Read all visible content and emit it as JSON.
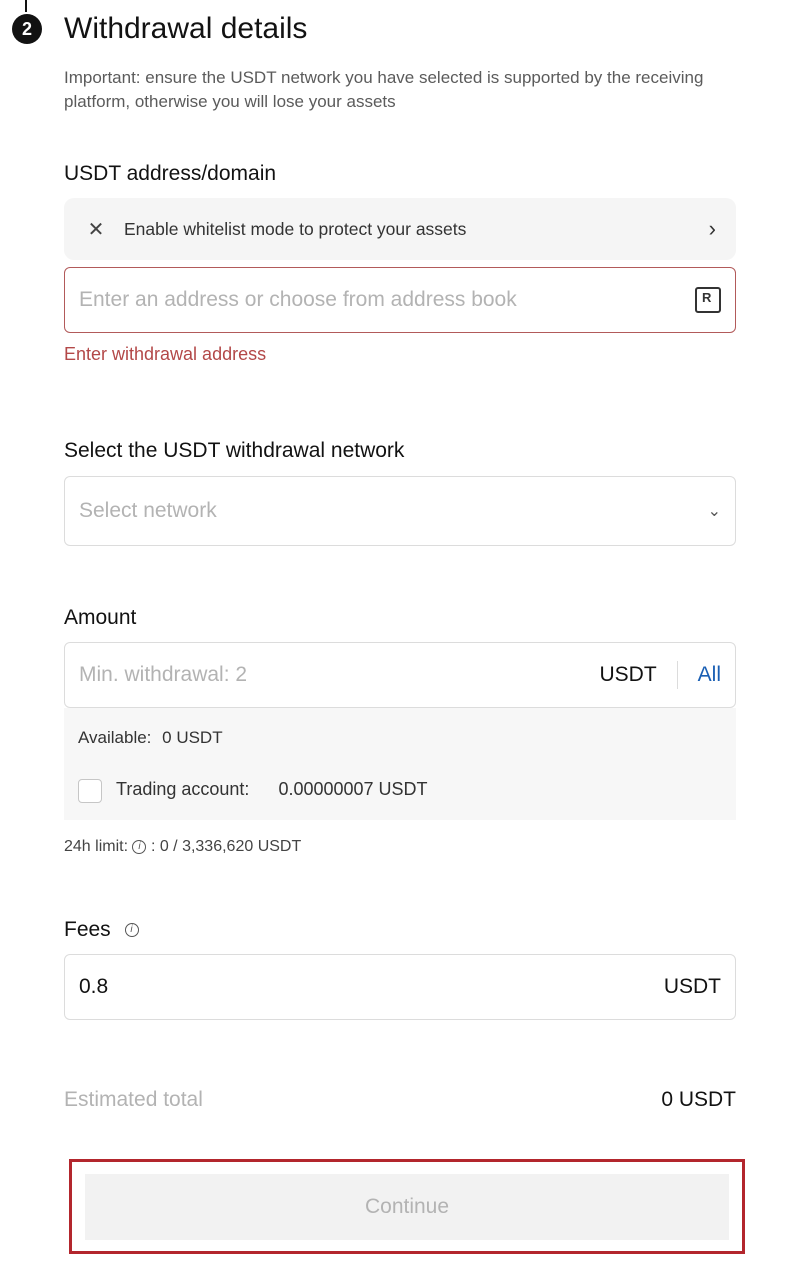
{
  "step": {
    "number": "2",
    "title": "Withdrawal details"
  },
  "notice": "Important: ensure the USDT network you have selected is supported by the receiving platform, otherwise you will lose your assets",
  "address": {
    "label": "USDT address/domain",
    "whitelist_text": "Enable whitelist mode to protect your assets",
    "placeholder": "Enter an address or choose from address book",
    "error": "Enter withdrawal address"
  },
  "network": {
    "label": "Select the USDT withdrawal network",
    "placeholder": "Select network"
  },
  "amount": {
    "label": "Amount",
    "placeholder": "Min. withdrawal: 2",
    "unit": "USDT",
    "all_label": "All",
    "available_label": "Available:",
    "available_value": "0 USDT",
    "trading_label": "Trading account:",
    "trading_value": "0.00000007 USDT",
    "limit_label": "24h limit:",
    "limit_value": ": 0 / 3,336,620 USDT"
  },
  "fees": {
    "label": "Fees",
    "value": "0.8",
    "unit": "USDT"
  },
  "estimated": {
    "label": "Estimated total",
    "value": "0 USDT"
  },
  "continue_label": "Continue",
  "colors": {
    "error": "#b34848",
    "link": "#1a5fb4",
    "highlight": "#b3262d"
  }
}
